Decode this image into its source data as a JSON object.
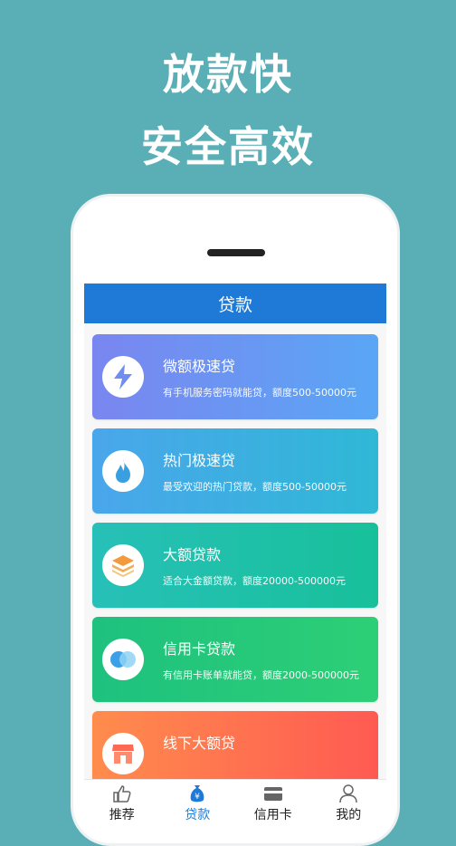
{
  "headline": {
    "line1": "放款快",
    "line2": "安全高效"
  },
  "app": {
    "title": "贷款"
  },
  "cards": [
    {
      "title": "微额极速贷",
      "desc": "有手机服务密码就能贷，额度500-50000元",
      "icon": "lightning-icon"
    },
    {
      "title": "热门极速贷",
      "desc": "最受欢迎的热门贷款，额度500-50000元",
      "icon": "flame-icon"
    },
    {
      "title": "大额贷款",
      "desc": "适合大金额贷款，额度20000-500000元",
      "icon": "layers-icon"
    },
    {
      "title": "信用卡贷款",
      "desc": "有信用卡账单就能贷，额度2000-500000元",
      "icon": "two-circles-icon"
    },
    {
      "title": "线下大额贷",
      "desc": "",
      "icon": "store-icon"
    }
  ],
  "tabbar": {
    "tabs": [
      {
        "label": "推荐",
        "icon": "thumbs-up-icon",
        "active": false
      },
      {
        "label": "贷款",
        "icon": "yen-bag-icon",
        "active": true
      },
      {
        "label": "信用卡",
        "icon": "credit-card-icon",
        "active": false
      },
      {
        "label": "我的",
        "icon": "user-icon",
        "active": false
      }
    ]
  },
  "colors": {
    "background": "#5aafb6",
    "brand": "#1e7ad6"
  }
}
